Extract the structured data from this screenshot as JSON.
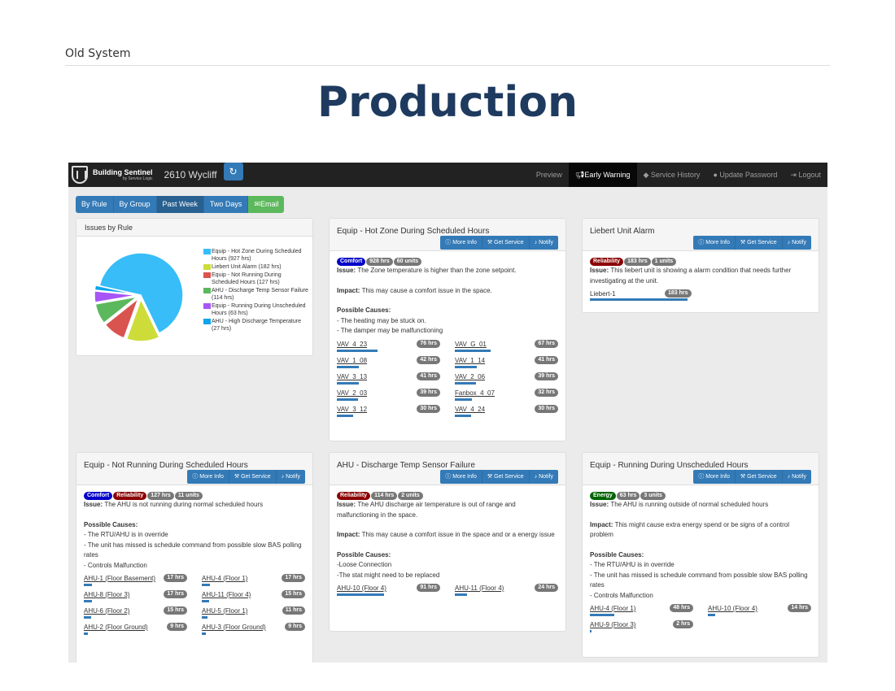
{
  "page": {
    "label": "Old System",
    "title": "Production"
  },
  "nav": {
    "brand": "Building Sentinel",
    "brand_sub": "by Service Logic",
    "building": "2610 Wycliff",
    "items": [
      "Preview",
      "Early Warning",
      "Service History",
      "Update Password",
      "Logout"
    ]
  },
  "toolbar": [
    "By Rule",
    "By Group",
    "Past Week",
    "Two Days",
    "Email"
  ],
  "action_buttons": {
    "more": "More Info",
    "service": "Get Service",
    "notify": "Notify"
  },
  "issues_by_rule": {
    "title": "Issues by Rule"
  },
  "chart_data": {
    "type": "pie",
    "title": "",
    "categories": [
      "Equip - Hot Zone During Scheduled Hours (927 hrs)",
      "Liebert Unit Alarm (182 hrs)",
      "Equip - Not Running During Scheduled Hours (127 hrs)",
      "AHU - Discharge Temp Sensor Failure (114 hrs)",
      "Equip - Running During Unscheduled Hours (63 hrs)",
      "AHU - High Discharge Temperature (27 hrs)"
    ],
    "values": [
      927,
      182,
      127,
      114,
      63,
      27
    ],
    "colors": [
      "#38bdf8",
      "#cddc39",
      "#d9534f",
      "#5cb85c",
      "#a855f7",
      "#0ea5e9"
    ],
    "legend": "right"
  },
  "cards": [
    {
      "title": "Equip - Hot Zone During Scheduled Hours",
      "badges": [
        [
          "Comfort",
          "b-comfort"
        ],
        [
          "928 hrs",
          "b-gray"
        ],
        [
          "60 units",
          "b-gray"
        ]
      ],
      "issue": "The Zone temperature is higher than the zone setpoint.",
      "impact": "This may cause a comfort issue in the space.",
      "causes": [
        "- The heating may be stuck on.",
        "- The damper may be malfunctioning"
      ],
      "items": [
        [
          "VAV_4_23",
          "76 hrs",
          50
        ],
        [
          "VAV_G_01",
          "67 hrs",
          44
        ],
        [
          "VAV_1_08",
          "42 hrs",
          27
        ],
        [
          "VAV_1_14",
          "41 hrs",
          27
        ],
        [
          "VAV_3_13",
          "41 hrs",
          27
        ],
        [
          "VAV_2_06",
          "39 hrs",
          26
        ],
        [
          "VAV_2_03",
          "39 hrs",
          26
        ],
        [
          "Fanbox_4_07",
          "32 hrs",
          21
        ],
        [
          "VAV_3_12",
          "30 hrs",
          20
        ],
        [
          "VAV_4_24",
          "30 hrs",
          20
        ]
      ]
    },
    {
      "title": "Liebert Unit Alarm",
      "badges": [
        [
          "Reliability",
          "b-reliab"
        ],
        [
          "183 hrs",
          "b-gray"
        ],
        [
          "1 units",
          "b-gray"
        ]
      ],
      "issue": "This liebert unit is showing a alarm condition that needs further investigating at the unit.",
      "items": [
        [
          "Liebert-1",
          "183 hrs",
          120
        ]
      ]
    },
    {
      "title": "Equip - Not Running During Scheduled Hours",
      "badges": [
        [
          "Comfort",
          "b-comfort"
        ],
        [
          "Reliability",
          "b-reliab"
        ],
        [
          "127 hrs",
          "b-gray"
        ],
        [
          "11 units",
          "b-gray"
        ]
      ],
      "issue": "The AHU is not running during normal scheduled hours",
      "causes": [
        "- The RTU/AHU is in override",
        "- The unit has missed is schedule command from possible slow BAS polling rates",
        "- Controls Malfunction"
      ],
      "items": [
        [
          "AHU-1 (Floor Basement)",
          "17 hrs",
          10
        ],
        [
          "AHU-4 (Floor 1)",
          "17 hrs",
          10
        ],
        [
          "AHU-8 (Floor 3)",
          "17 hrs",
          10
        ],
        [
          "AHU-11 (Floor 4)",
          "15 hrs",
          9
        ],
        [
          "AHU-6 (Floor 2)",
          "15 hrs",
          9
        ],
        [
          "AHU-5 (Floor 1)",
          "11 hrs",
          7
        ],
        [
          "AHU-2 (Floor Ground)",
          "9 hrs",
          5
        ],
        [
          "AHU-3 (Floor Ground)",
          "9 hrs",
          5
        ]
      ]
    },
    {
      "title": "AHU - Discharge Temp Sensor Failure",
      "badges": [
        [
          "Reliability",
          "b-reliab"
        ],
        [
          "114 hrs",
          "b-gray"
        ],
        [
          "2 units",
          "b-gray"
        ]
      ],
      "issue": "The AHU discharge air temperature is out of range and malfunctioning in the space.",
      "impact": "This may cause a comfort issue in the space and or a energy issue",
      "causes": [
        "-Loose Connection",
        "-The stat might need to be replaced"
      ],
      "items": [
        [
          "AHU-10 (Floor 4)",
          "91 hrs",
          58
        ],
        [
          "AHU-11 (Floor 4)",
          "24 hrs",
          15
        ]
      ]
    },
    {
      "title": "Equip - Running During Unscheduled Hours",
      "badges": [
        [
          "Energy",
          "b-energy"
        ],
        [
          "63 hrs",
          "b-gray"
        ],
        [
          "3 units",
          "b-gray"
        ]
      ],
      "issue": "The AHU is running outside of normal scheduled hours",
      "impact": "This might cause extra energy spend or be signs of a control problem",
      "causes": [
        "- The RTU/AHU is in override",
        "- The unit has missed is schedule command from possible slow BAS polling rates",
        "- Controls Malfunction"
      ],
      "items": [
        [
          "AHU-4 (Floor 1)",
          "48 hrs",
          30
        ],
        [
          "AHU-10 (Floor 4)",
          "14 hrs",
          9
        ],
        [
          "AHU-9 (Floor 3)",
          "2 hrs",
          2
        ]
      ]
    }
  ]
}
